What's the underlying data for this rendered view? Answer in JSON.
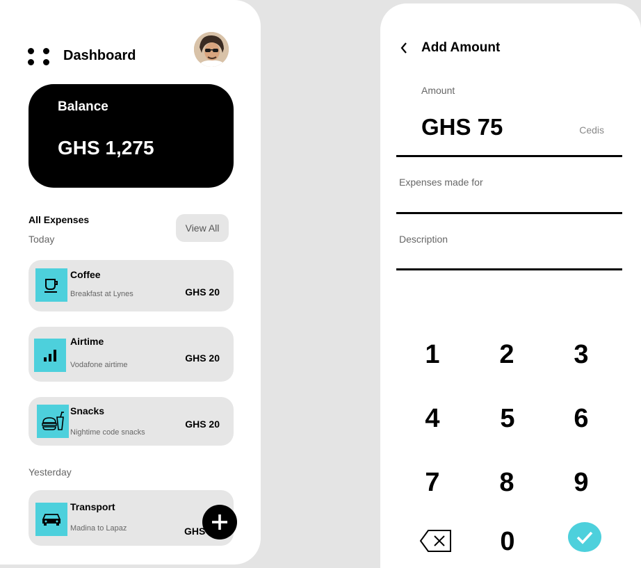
{
  "dashboard": {
    "title": "Dashboard",
    "balance_label": "Balance",
    "balance_value": "GHS 1,275",
    "all_expenses_label": "All Expenses",
    "view_all_label": "View All",
    "today_label": "Today",
    "yesterday_label": "Yesterday",
    "expenses": [
      {
        "name": "Coffee",
        "sub": "Breakfast at Lynes",
        "amount": "GHS 20",
        "icon": "coffee-cup-icon"
      },
      {
        "name": "Airtime",
        "sub": "Vodafone airtime",
        "amount": "GHS 20",
        "icon": "signal-bars-icon"
      },
      {
        "name": "Snacks",
        "sub": "Nightime code snacks",
        "amount": "GHS 20",
        "icon": "burger-drink-icon"
      },
      {
        "name": "Transport",
        "sub": "Madina to Lapaz",
        "amount": "GHS",
        "icon": "car-icon"
      }
    ],
    "fab_icon": "plus-icon"
  },
  "add_amount": {
    "title": "Add Amount",
    "amount_label": "Amount",
    "amount_value": "GHS 75",
    "currency_label": "Cedis",
    "expenses_made_for_label": "Expenses made for",
    "description_label": "Description",
    "keys": [
      "1",
      "2",
      "3",
      "4",
      "5",
      "6",
      "7",
      "8",
      "9",
      "0"
    ],
    "backspace_icon": "backspace-icon",
    "confirm_icon": "checkmark-icon"
  },
  "colors": {
    "accent": "#4dd0dc",
    "card_bg": "#e6e6e6",
    "background": "#e4e4e4"
  }
}
